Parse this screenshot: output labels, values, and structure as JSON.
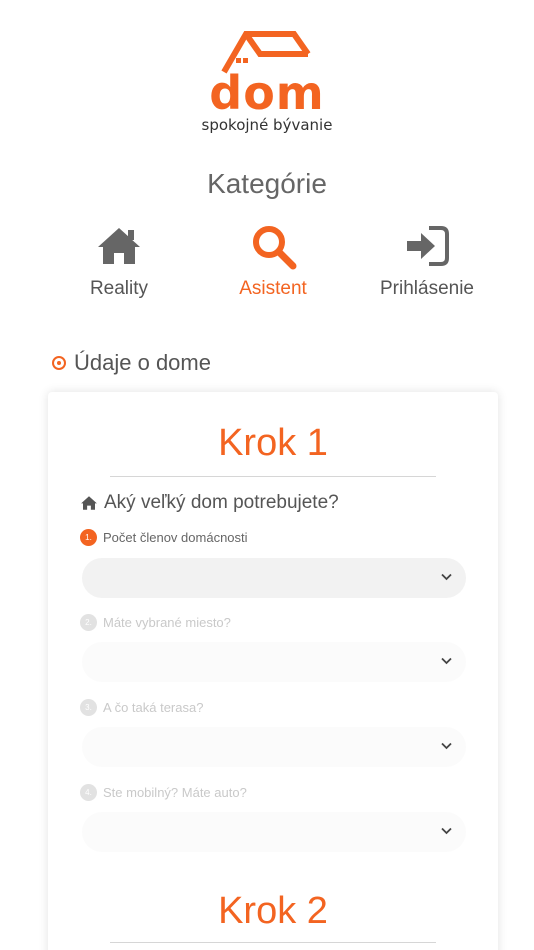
{
  "brand": {
    "name": "dom",
    "tagline": "spokojné bývanie",
    "accent_color": "#f36421"
  },
  "categories": {
    "title": "Kategórie",
    "items": [
      {
        "label": "Reality",
        "icon": "home-icon",
        "active": false
      },
      {
        "label": "Asistent",
        "icon": "search-icon",
        "active": true
      },
      {
        "label": "Prihlásenie",
        "icon": "login-icon",
        "active": false
      }
    ]
  },
  "section": {
    "title": "Údaje o dome",
    "icon": "radio-dot-icon"
  },
  "form": {
    "step1_title": "Krok 1",
    "question": "Aký veľký dom potrebujete?",
    "question_icon": "home-icon",
    "fields": [
      {
        "number": "1.",
        "label": "Počet členov domácnosti",
        "value": "",
        "active": true
      },
      {
        "number": "2.",
        "label": "Máte vybrané miesto?",
        "value": "",
        "active": false
      },
      {
        "number": "3.",
        "label": "A čo taká terasa?",
        "value": "",
        "active": false
      },
      {
        "number": "4.",
        "label": "Ste mobilný? Máte auto?",
        "value": "",
        "active": false
      }
    ],
    "step2_title": "Krok 2"
  }
}
